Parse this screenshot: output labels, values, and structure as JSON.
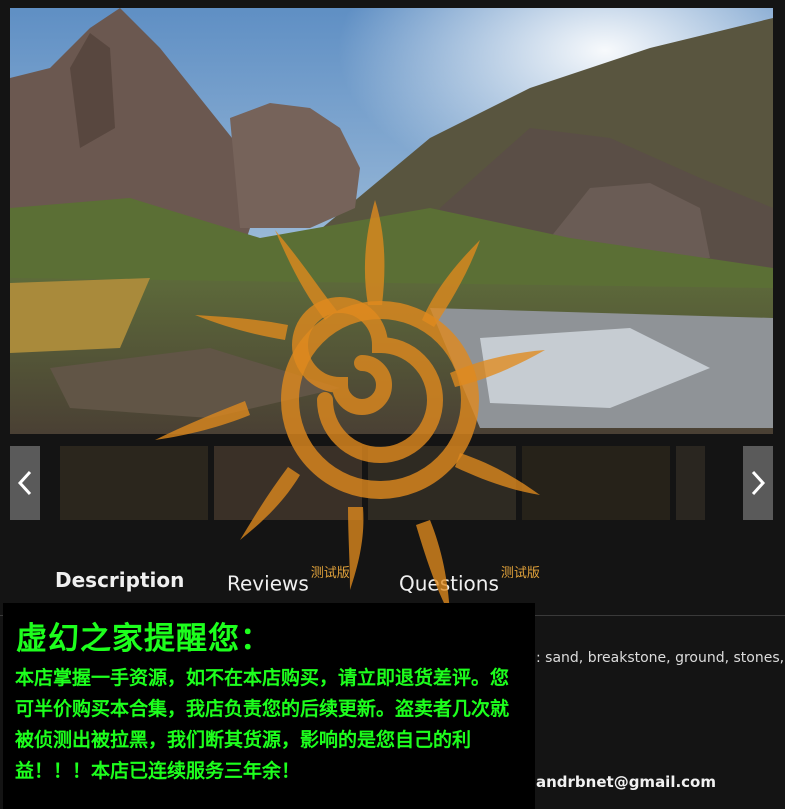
{
  "gallery": {
    "main_image_alt": "terrain landscape screenshot",
    "prev_icon": "chevron-left-icon",
    "next_icon": "chevron-right-icon",
    "thumbnail_count": 5
  },
  "tabs": [
    {
      "label": "Description",
      "badge": ""
    },
    {
      "label": "Reviews",
      "badge": "测试版"
    },
    {
      "label": "Questions",
      "badge": "测试版"
    }
  ],
  "description": {
    "text_fragment": ": sand, breakstone, ground, stones, gra",
    "email": "andrbnet@gmail.com"
  },
  "notice": {
    "title": "虚幻之家提醒您：",
    "body": "本店掌握一手资源，如不在本店购买，请立即退货差评。您可半价购买本合集，我店负责您的后续更新。盗卖者几次就被侦测出被拉黑，我们断其货源，影响的是您自己的利益！！！本店已连续服务三年余！"
  },
  "colors": {
    "page_bg": "#141414",
    "notice_text": "#1dff1d",
    "badge": "#e0a13a",
    "watermark": "#e08a1e"
  }
}
